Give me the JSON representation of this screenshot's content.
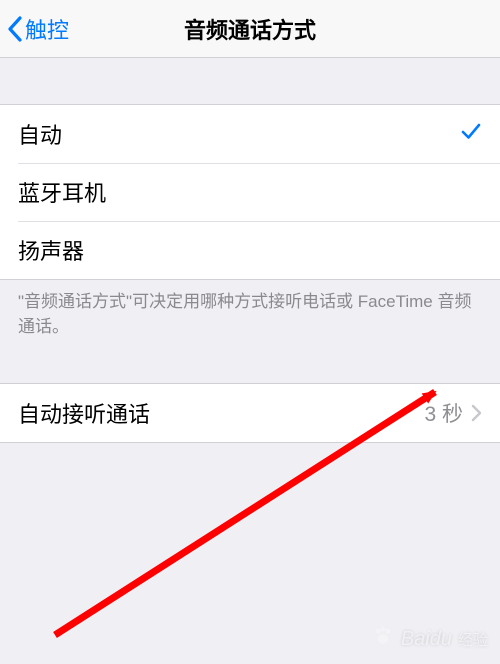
{
  "nav": {
    "back_label": "触控",
    "title": "音频通话方式"
  },
  "options": [
    {
      "label": "自动",
      "selected": true
    },
    {
      "label": "蓝牙耳机",
      "selected": false
    },
    {
      "label": "扬声器",
      "selected": false
    }
  ],
  "footer_note": "\"音频通话方式\"可决定用哪种方式接听电话或 FaceTime 音频通话。",
  "auto_answer": {
    "label": "自动接听通话",
    "value": "3 秒"
  },
  "watermark": {
    "brand": "Baidu",
    "sub": "经验"
  }
}
